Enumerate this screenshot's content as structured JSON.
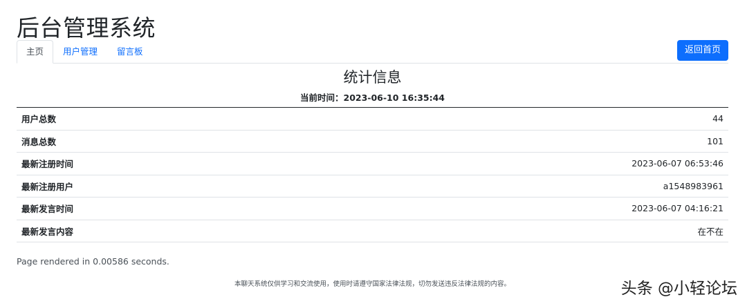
{
  "header": {
    "title": "后台管理系统",
    "home_button": "返回首页"
  },
  "tabs": [
    {
      "label": "主页",
      "active": true
    },
    {
      "label": "用户管理",
      "active": false
    },
    {
      "label": "留言板",
      "active": false
    }
  ],
  "stats": {
    "title": "统计信息",
    "current_time_label": "当前时间：",
    "current_time_value": "2023-06-10 16:35:44",
    "rows": [
      {
        "label": "用户总数",
        "value": "44"
      },
      {
        "label": "消息总数",
        "value": "101"
      },
      {
        "label": "最新注册时间",
        "value": "2023-06-07 06:53:46"
      },
      {
        "label": "最新注册用户",
        "value": "a1548983961"
      },
      {
        "label": "最新发言时间",
        "value": "2023-06-07 04:16:21"
      },
      {
        "label": "最新发言内容",
        "value": "在不在"
      }
    ]
  },
  "footer": {
    "render_info": "Page rendered in 0.00586 seconds.",
    "disclaimer": "本聊天系统仅供学习和交流使用，使用时请遵守国家法律法规，切勿发送违反法律法规的内容。"
  },
  "watermark": "头条 @小轻论坛",
  "colors": {
    "primary": "#0d6efd",
    "text": "#212529",
    "border": "#dee2e6"
  }
}
